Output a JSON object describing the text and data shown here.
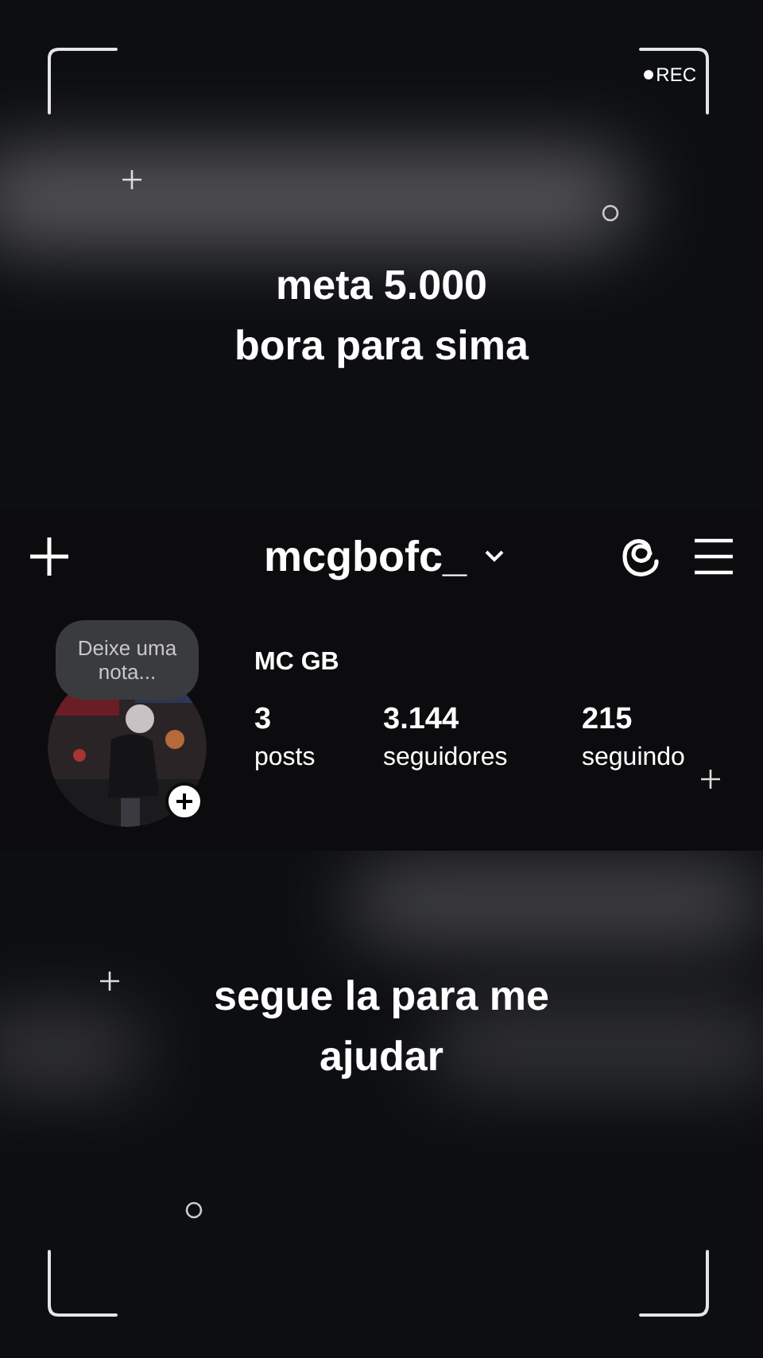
{
  "overlay": {
    "rec_label": "REC",
    "caption_top": [
      "meta 5.000",
      "bora para sima"
    ],
    "caption_bottom": "segue la para me ajudar"
  },
  "profile": {
    "username": "mcgbofc_",
    "note_placeholder": "Deixe uma nota...",
    "display_name": "MC GB",
    "stats": [
      {
        "value": "3",
        "label": "posts"
      },
      {
        "value": "3.144",
        "label": "seguidores"
      },
      {
        "value": "215",
        "label": "seguindo"
      }
    ]
  }
}
